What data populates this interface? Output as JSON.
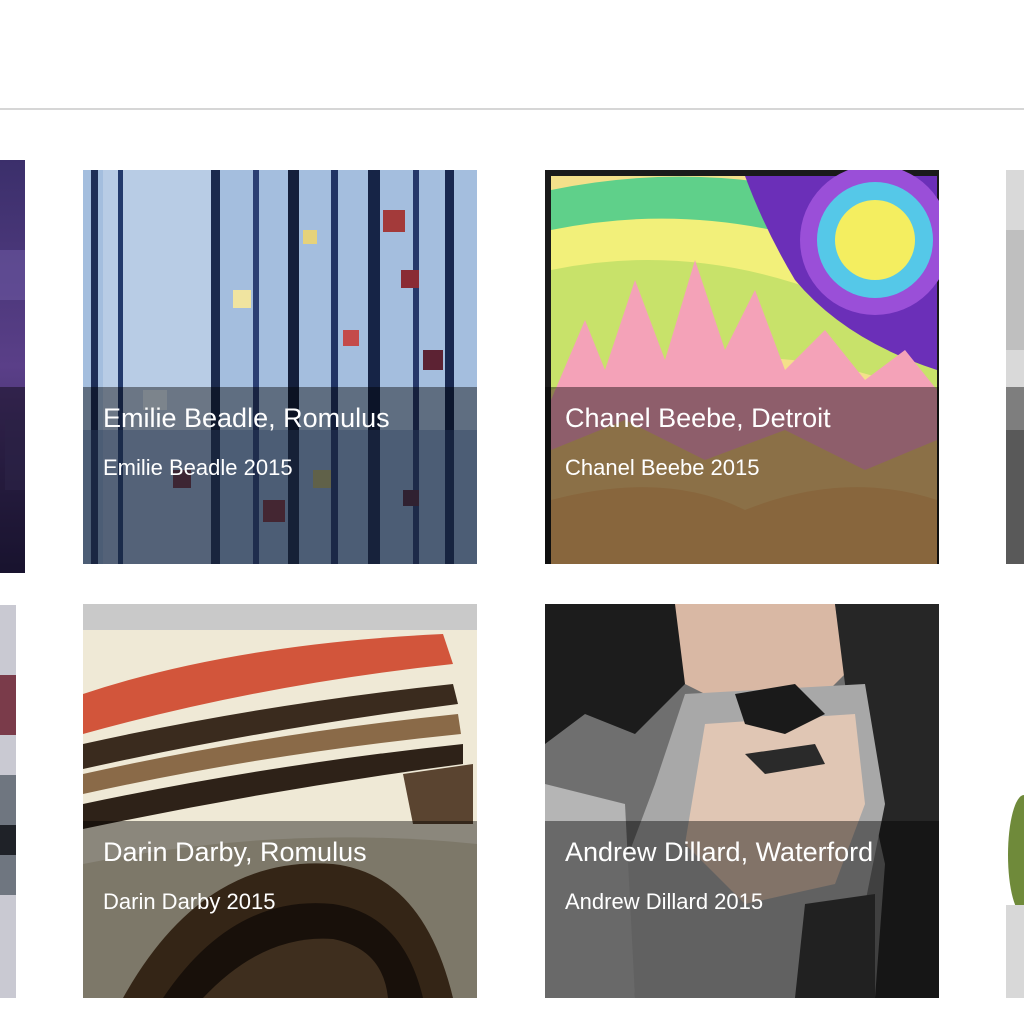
{
  "gallery": {
    "items": [
      {
        "title": "Emilie Beadle, Romulus",
        "subtitle": "Emilie Beadle 2015"
      },
      {
        "title": "Chanel Beebe, Detroit",
        "subtitle": "Chanel Beebe 2015"
      },
      {
        "title": "Darin Darby, Romulus",
        "subtitle": "Darin Darby 2015"
      },
      {
        "title": "Andrew Dillard, Waterford",
        "subtitle": "Andrew Dillard 2015"
      }
    ]
  }
}
